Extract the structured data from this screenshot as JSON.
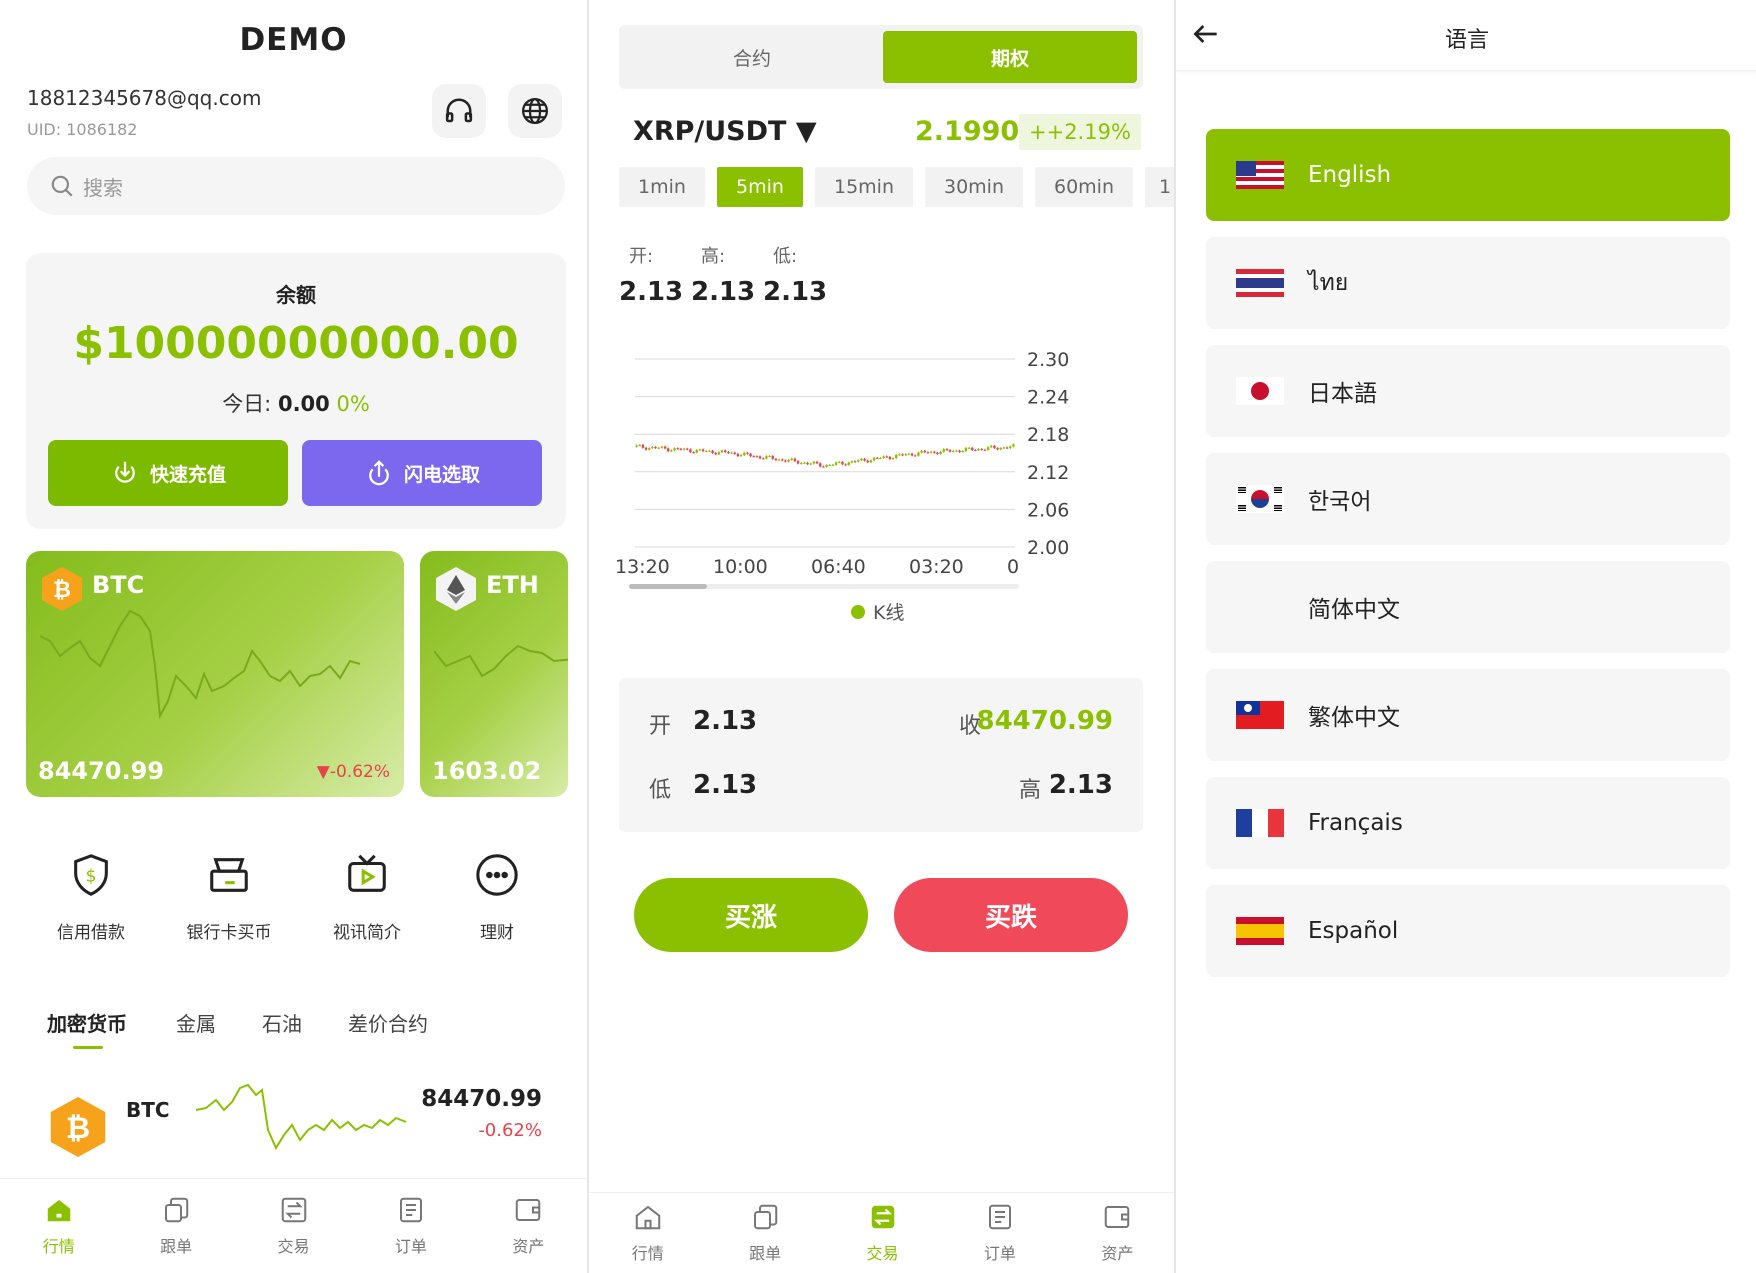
{
  "colors": {
    "accent": "#8bc000",
    "purple": "#7b68ee",
    "red": "#f04a5a",
    "down": "#e8434b"
  },
  "home": {
    "title": "DEMO",
    "email": "18812345678@qq.com",
    "uid": "UID: 1086182",
    "search_placeholder": "搜索",
    "balance": {
      "label": "余额",
      "value": "$10000000000.00",
      "today_label": "今日:",
      "today_value": "0.00",
      "today_pct": "0%"
    },
    "buttons": {
      "deposit": "快速充值",
      "withdraw": "闪电选取"
    },
    "coin_cards": [
      {
        "symbol": "BTC",
        "price": "84470.99",
        "change": "▼-0.62%"
      },
      {
        "symbol": "ETH",
        "price": "1603.02"
      }
    ],
    "features": [
      {
        "label": "信用借款",
        "icon": "shield-dollar-icon"
      },
      {
        "label": "银行卡买币",
        "icon": "card-terminal-icon"
      },
      {
        "label": "视讯简介",
        "icon": "tv-play-icon"
      },
      {
        "label": "理财",
        "icon": "more-dots-icon"
      }
    ],
    "categories": [
      "加密货币",
      "金属",
      "石油",
      "差价合约"
    ],
    "list": [
      {
        "symbol": "BTC",
        "price": "84470.99",
        "change": "-0.62%"
      }
    ],
    "tabbar": [
      "行情",
      "跟单",
      "交易",
      "订单",
      "资产"
    ]
  },
  "trade": {
    "segments": [
      "合约",
      "期权"
    ],
    "pair": "XRP/USDT ▼",
    "price": "2.19906",
    "change": "++2.19%",
    "intervals": [
      "1min",
      "5min",
      "15min",
      "30min",
      "60min",
      "1"
    ],
    "ohl_labels": [
      "开:",
      "高:",
      "低:"
    ],
    "ohl_values": [
      "2.13",
      "2.13",
      "2.13"
    ],
    "chart": {
      "y_ticks": [
        "2.30",
        "2.24",
        "2.18",
        "2.12",
        "2.06",
        "2.00"
      ],
      "x_ticks": [
        "13:20",
        "10:00",
        "06:40",
        "03:20",
        "0"
      ],
      "legend": "K线"
    },
    "summary": {
      "open_label": "开",
      "open": "2.13",
      "close_label": "收",
      "close": "84470.99",
      "low_label": "低",
      "low": "2.13",
      "high_label": "高",
      "high": "2.13"
    },
    "buy_up": "买涨",
    "buy_down": "买跌",
    "tabbar": [
      "行情",
      "跟单",
      "交易",
      "订单",
      "资产"
    ]
  },
  "language": {
    "title": "语言",
    "items": [
      {
        "name": "English",
        "flag": "us-flag-icon"
      },
      {
        "name": "ไทย",
        "flag": "th-flag-icon"
      },
      {
        "name": "日本語",
        "flag": "jp-flag-icon"
      },
      {
        "name": "한국어",
        "flag": "kr-flag-icon"
      },
      {
        "name": "简体中文",
        "flag": ""
      },
      {
        "name": "繁体中文",
        "flag": "tw-flag-icon"
      },
      {
        "name": "Français",
        "flag": "fr-flag-icon"
      },
      {
        "name": "Español",
        "flag": "es-flag-icon"
      }
    ]
  },
  "chart_data": {
    "type": "line",
    "title": "",
    "xlabel": "",
    "ylabel": "",
    "ylim": [
      2.0,
      2.3
    ],
    "categories": [
      "13:20",
      "10:00",
      "06:40",
      "03:20",
      "0"
    ],
    "series": [
      {
        "name": "K线",
        "values": [
          2.16,
          2.15,
          2.13,
          2.15,
          2.16
        ]
      }
    ]
  }
}
